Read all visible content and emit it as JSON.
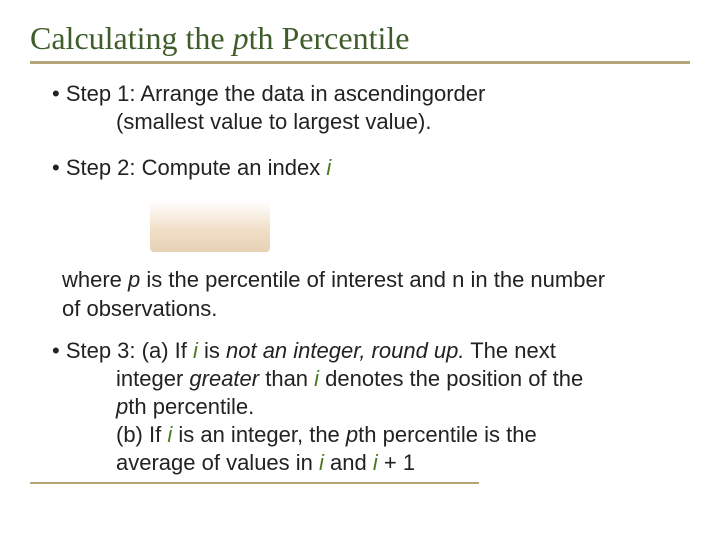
{
  "title_prefix": "Calculating the ",
  "title_p": "p",
  "title_suffix": "th Percentile",
  "step1": {
    "bullet": "• Step 1: Arrange the data in ascendingorder",
    "cont": "(smallest value to largest value)."
  },
  "step2": {
    "bullet_prefix": "• Step 2: Compute an index ",
    "i": "i"
  },
  "where": {
    "line1_a": "where ",
    "line1_p": "p",
    "line1_b": " is the percentile of interest and n in the number",
    "line2": "of observations."
  },
  "step3": {
    "lead_a": "• Step 3: (a) If ",
    "lead_i": "i",
    "lead_b": " is ",
    "lead_ital": "not an integer, round up.",
    "lead_c": " The next",
    "l2_a": "integer ",
    "l2_ital": "greater",
    "l2_b": " than ",
    "l2_i": "i",
    "l2_c": " denotes the position of the",
    "l3_p": "p",
    "l3_a": "th percentile.",
    "l4_a": "(b) If ",
    "l4_i1": "i",
    "l4_b": " is an integer, the ",
    "l4_p": "p",
    "l4_c": "th percentile is the",
    "l5_a": "average of values in ",
    "l5_i1": "i",
    "l5_b": " and  ",
    "l5_i2": "i",
    "l5_c": " + 1"
  }
}
